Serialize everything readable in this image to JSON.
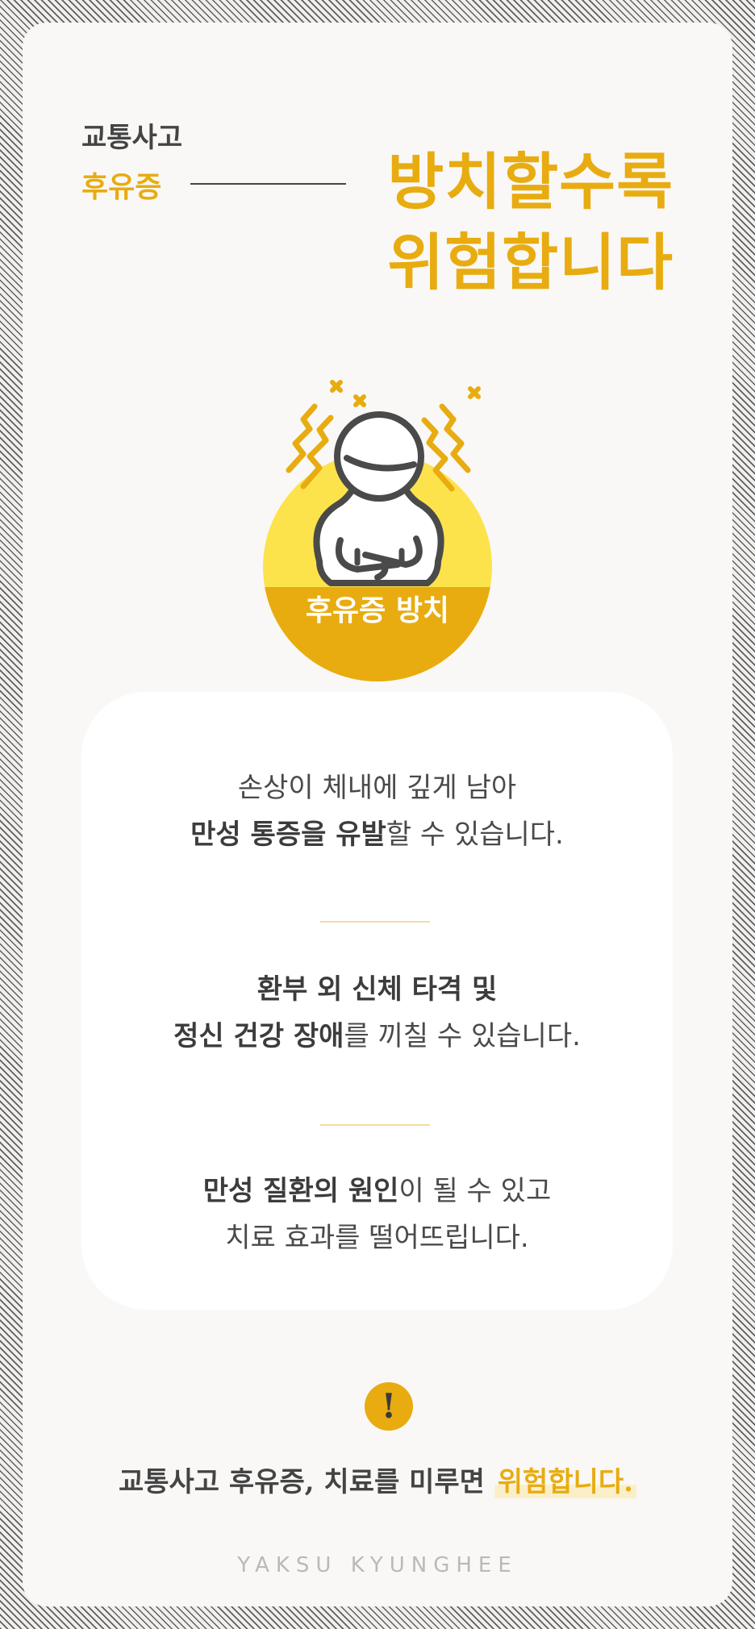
{
  "header": {
    "line1": "교통사고",
    "line2": "후유증",
    "big_line1": "방치할수록",
    "big_line2": "위험합니다"
  },
  "badge": {
    "label": "후유증 방치",
    "icon": "person-in-pain-icon"
  },
  "info": {
    "items": [
      {
        "line1": "손상이 체내에 깊게 남아",
        "line2_bold": "만성 통증을 유발",
        "line2_rest": "할 수 있습니다."
      },
      {
        "line1_bold": "환부 외 신체 타격 및",
        "line2_bold": "정신 건강 장애",
        "line2_rest": "를 끼칠 수 있습니다."
      },
      {
        "line1_bold": "만성 질환의 원인",
        "line1_rest": "이 될 수 있고",
        "line2": "치료 효과를 떨어뜨립니다."
      }
    ]
  },
  "warning": {
    "icon_glyph": "!",
    "text": "교통사고 후유증, 치료를 미루면 ",
    "highlight": "위험합니다."
  },
  "footer": {
    "brand": "YAKSU KYUNGHEE"
  },
  "colors": {
    "accent": "#e8ac10",
    "text": "#444444",
    "card": "#f9f8f6"
  }
}
